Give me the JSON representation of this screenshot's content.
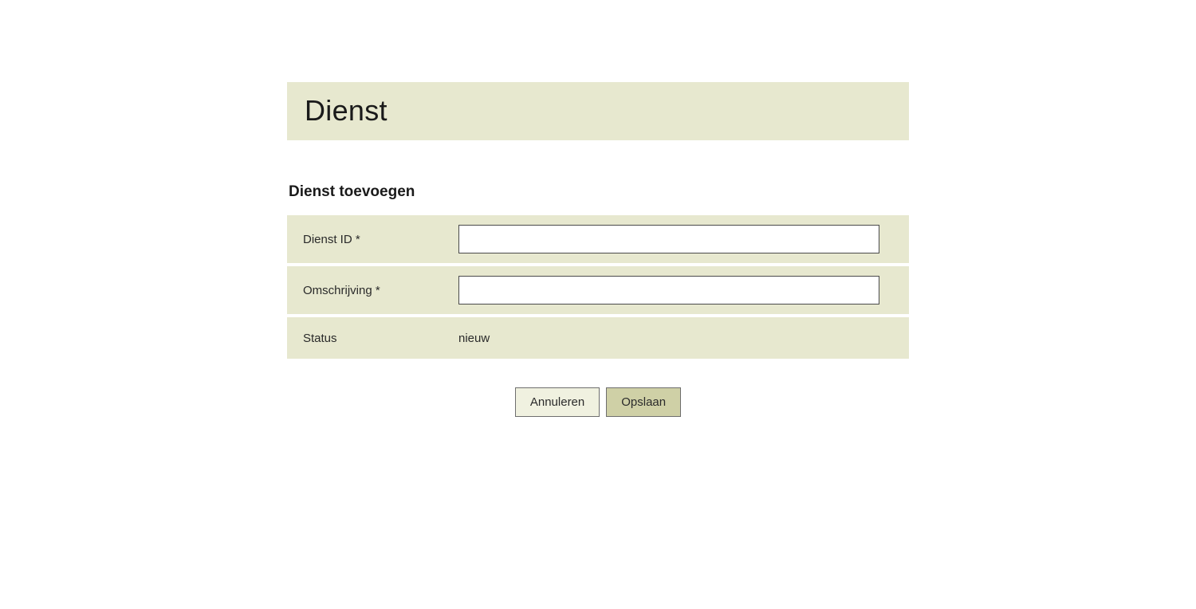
{
  "header": {
    "title": "Dienst"
  },
  "form": {
    "section_title": "Dienst toevoegen",
    "fields": {
      "dienst_id": {
        "label": "Dienst ID *",
        "value": ""
      },
      "omschrijving": {
        "label": "Omschrijving *",
        "value": ""
      },
      "status": {
        "label": "Status",
        "value": "nieuw"
      }
    }
  },
  "buttons": {
    "cancel": "Annuleren",
    "save": "Opslaan"
  }
}
